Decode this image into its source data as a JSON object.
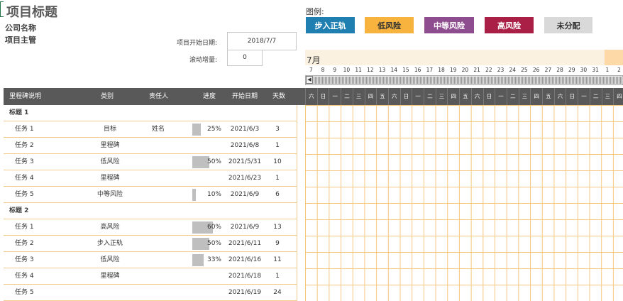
{
  "header": {
    "title": "项目标题",
    "company": "公司名称",
    "manager": "项目主管",
    "start_label": "项目开始日期:",
    "start_value": "2018/7/7",
    "scroll_label": "滚动增量:",
    "scroll_value": "0"
  },
  "legend": {
    "title": "图例:",
    "items": [
      {
        "label": "步入正轨",
        "bg": "#1f7fb0",
        "fg": "#ffffff"
      },
      {
        "label": "低风险",
        "bg": "#f7b33e",
        "fg": "#333333"
      },
      {
        "label": "中等风险",
        "bg": "#8e4d8e",
        "fg": "#ffffff"
      },
      {
        "label": "高风险",
        "bg": "#a91f45",
        "fg": "#ffffff"
      },
      {
        "label": "未分配",
        "bg": "#d9d9d9",
        "fg": "#333333"
      }
    ]
  },
  "gantt": {
    "month": "7月",
    "day_numbers": [
      "7",
      "8",
      "9",
      "10",
      "11",
      "12",
      "13",
      "14",
      "15",
      "16",
      "17",
      "18",
      "19",
      "20",
      "21",
      "22",
      "23",
      "24",
      "25",
      "26",
      "27",
      "28",
      "29",
      "30",
      "31",
      "1",
      "2"
    ],
    "weekdays": [
      "六",
      "日",
      "一",
      "二",
      "三",
      "四",
      "五",
      "六",
      "日",
      "一",
      "二",
      "三",
      "四",
      "五",
      "六",
      "日",
      "一",
      "二",
      "三",
      "四",
      "五",
      "六",
      "日",
      "一",
      "二",
      "三",
      "四"
    ]
  },
  "columns": [
    "里程碑说明",
    "类别",
    "责任人",
    "进度",
    "开始日期",
    "天数"
  ],
  "rows": [
    {
      "type": "section",
      "name": "标题 1"
    },
    {
      "type": "task",
      "name": "任务 1",
      "category": "目标",
      "owner": "姓名",
      "progress": "25%",
      "progress_value": 25,
      "start": "2021/6/3",
      "days": "3"
    },
    {
      "type": "task",
      "name": "任务 2",
      "category": "里程碑",
      "owner": "",
      "progress": "",
      "progress_value": 0,
      "start": "2021/6/8",
      "days": "1"
    },
    {
      "type": "task",
      "name": "任务 3",
      "category": "低风险",
      "owner": "",
      "progress": "50%",
      "progress_value": 50,
      "start": "2021/5/31",
      "days": "10"
    },
    {
      "type": "task",
      "name": "任务 4",
      "category": "里程碑",
      "owner": "",
      "progress": "",
      "progress_value": 0,
      "start": "2021/6/23",
      "days": "1"
    },
    {
      "type": "task",
      "name": "任务 5",
      "category": "中等风险",
      "owner": "",
      "progress": "10%",
      "progress_value": 10,
      "start": "2021/6/9",
      "days": "6"
    },
    {
      "type": "section",
      "name": "标题 2"
    },
    {
      "type": "task",
      "name": "任务 1",
      "category": "高风险",
      "owner": "",
      "progress": "60%",
      "progress_value": 60,
      "start": "2021/6/9",
      "days": "13"
    },
    {
      "type": "task",
      "name": "任务 2",
      "category": "步入正轨",
      "owner": "",
      "progress": "50%",
      "progress_value": 50,
      "start": "2021/6/11",
      "days": "9"
    },
    {
      "type": "task",
      "name": "任务 3",
      "category": "低风险",
      "owner": "",
      "progress": "33%",
      "progress_value": 33,
      "start": "2021/6/16",
      "days": "11"
    },
    {
      "type": "task",
      "name": "任务 4",
      "category": "里程碑",
      "owner": "",
      "progress": "",
      "progress_value": 0,
      "start": "2021/6/18",
      "days": "1"
    },
    {
      "type": "task",
      "name": "任务 5",
      "category": "",
      "owner": "",
      "progress": "",
      "progress_value": 0,
      "start": "2021/6/19",
      "days": "24"
    }
  ]
}
